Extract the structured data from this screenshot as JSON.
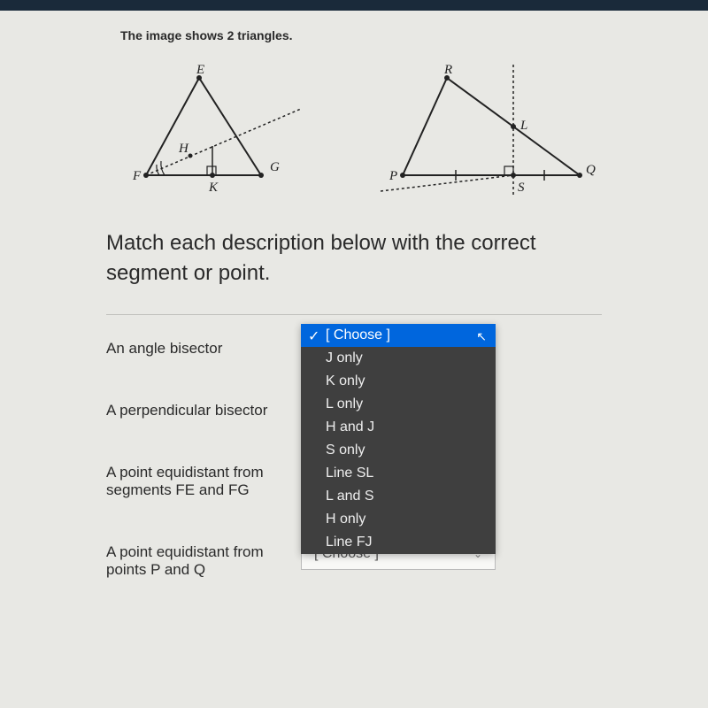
{
  "intro": "The image shows 2 triangles.",
  "instruction": "Match each description below with the correct segment or point.",
  "triangle1": {
    "labels": {
      "E": "E",
      "F": "F",
      "G": "G",
      "H": "H",
      "K": "K"
    }
  },
  "triangle2": {
    "labels": {
      "R": "R",
      "P": "P",
      "Q": "Q",
      "L": "L",
      "S": "S"
    }
  },
  "rows": {
    "r1": {
      "label": "An angle bisector"
    },
    "r2": {
      "label": "A perpendicular bisector"
    },
    "r3": {
      "label": "A point equidistant from segments FE and FG"
    },
    "r4": {
      "label": "A point equidistant from points P and Q"
    }
  },
  "dropdown": {
    "placeholder": "[ Choose ]",
    "options": {
      "o0": "[ Choose ]",
      "o1": "J only",
      "o2": "K only",
      "o3": "L only",
      "o4": "H and J",
      "o5": "S only",
      "o6": "Line SL",
      "o7": "L and S",
      "o8": "H only",
      "o9": "Line FJ"
    }
  }
}
